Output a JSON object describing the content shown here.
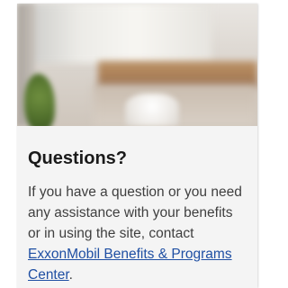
{
  "card": {
    "title": "Questions?",
    "body_prefix": "If you have a question or you need any assistance with your benefits or in using the site, contact ",
    "link_text": "ExxonMobil Benefits & Programs Center",
    "body_suffix": ".",
    "image_description_icon": "office-photo"
  },
  "colors": {
    "card_bg": "#f4f4f4",
    "title": "#1a1a1a",
    "body": "#3f3f3f",
    "link": "#1f4fa3"
  }
}
